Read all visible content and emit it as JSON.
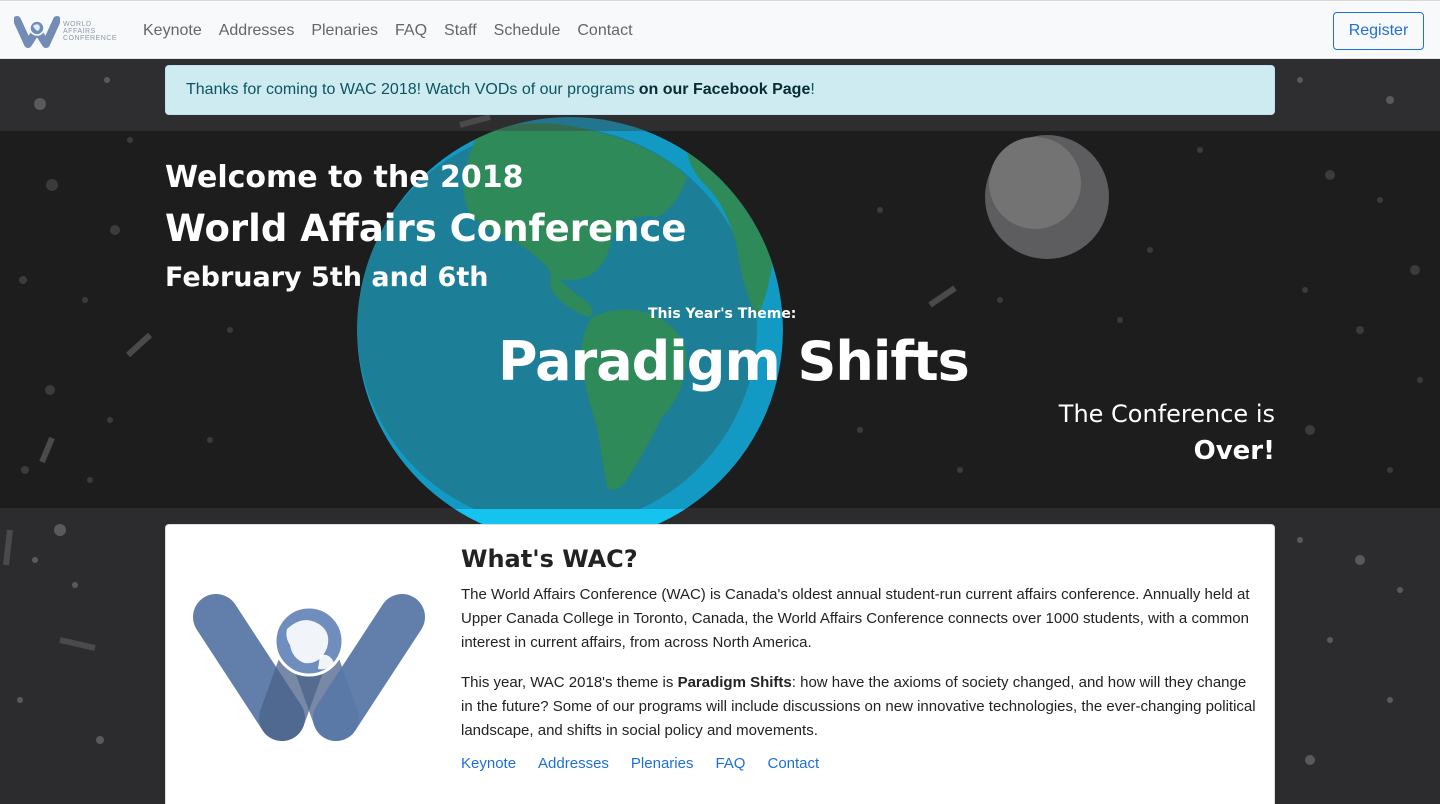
{
  "navbar": {
    "brand_lines": [
      "WORLD",
      "AFFAIRS",
      "CONFERENCE"
    ],
    "links": [
      "Keynote",
      "Addresses",
      "Plenaries",
      "FAQ",
      "Staff",
      "Schedule",
      "Contact"
    ],
    "register_label": "Register"
  },
  "alert": {
    "text": "Thanks for coming to WAC 2018! Watch VODs of our programs",
    "link_text": "on our Facebook Page",
    "tail": "!"
  },
  "hero": {
    "welcome": "Welcome to the 2018",
    "conference_name": "World Affairs Conference",
    "dates": "February 5th and 6th",
    "theme_label": "This Year's Theme:",
    "theme_name": "Paradigm Shifts",
    "status_line1": "The Conference is",
    "status_line2": "Over!"
  },
  "about": {
    "title": "What's WAC?",
    "paragraph1": "The World Affairs Conference (WAC) is Canada's oldest annual student-run current affairs conference. Annually held at Upper Canada College in Toronto, Canada, the World Affairs Conference connects over 1000 students, with a common interest in current affairs, from across North America.",
    "paragraph2_before": "This year, WAC 2018's theme is ",
    "paragraph2_bold": "Paradigm Shifts",
    "paragraph2_after": ": how have the axioms of society changed, and how will they change in the future? Some of our programs will include discussions on new innovative technologies, the ever-changing political landscape, and shifts in social policy and movements.",
    "links": [
      "Keynote",
      "Addresses",
      "Plenaries",
      "FAQ",
      "Contact"
    ]
  },
  "colors": {
    "accent": "#1e6fd9",
    "alert_bg": "#cdebf0",
    "space_dark": "#1e1d1e",
    "space": "#2c2b2e",
    "ocean": "#1a8fb3",
    "land": "#2e8b57",
    "logo_blue": "#5a79a8"
  },
  "icons": [
    "wac-logo-icon",
    "earth-illustration",
    "moon-illustration",
    "wac-globe-logo-icon"
  ]
}
